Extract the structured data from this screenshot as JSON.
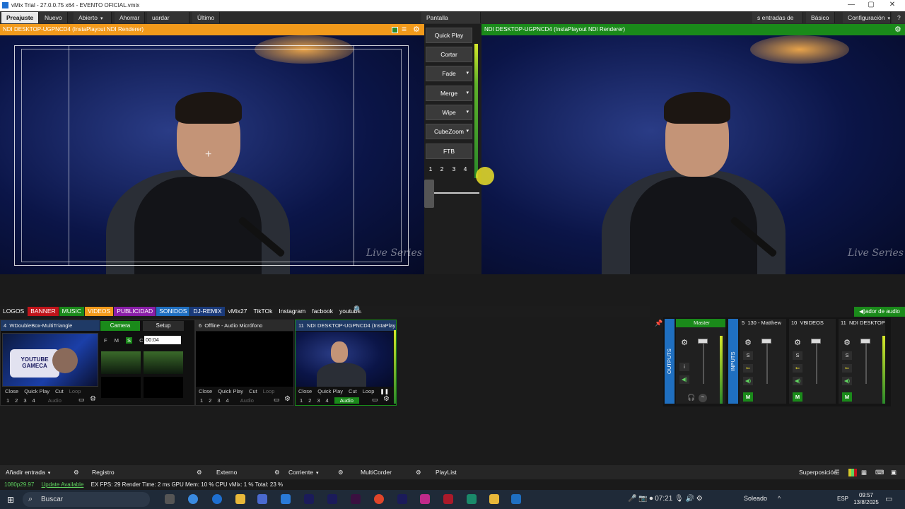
{
  "window": {
    "title": "vMix Trial - 27.0.0.75 x64 - EVENTO OFICIAL.vmix"
  },
  "menu": {
    "items": [
      "Preajuste",
      "Nuevo",
      "Abierto",
      "Ahorrar",
      "uardar com",
      "Último"
    ],
    "fullscreen": "Pantalla Completa",
    "right_items": [
      "s entradas de pa",
      "Básico",
      "Configuración",
      "?"
    ]
  },
  "preview": {
    "title": "NDI DESKTOP-UGPNCD4 (InstaPlayout NDI Renderer)"
  },
  "program": {
    "title": "NDI DESKTOP-UGPNCD4 (InstaPlayout NDI Renderer)"
  },
  "watermark": "Live Series",
  "transitions": {
    "buttons": [
      "Quick Play",
      "Cortar",
      "Fade",
      "Merge",
      "Wipe",
      "CubeZoom",
      "FTB"
    ],
    "numbers": [
      "1",
      "2",
      "3",
      "4"
    ]
  },
  "tabs": [
    {
      "label": "LOGOS",
      "color": "#1c1c1c"
    },
    {
      "label": "BANNER",
      "color": "#c0141a"
    },
    {
      "label": "MUSIC",
      "color": "#1a8a1a"
    },
    {
      "label": "VIDEOS",
      "color": "#f29a1b"
    },
    {
      "label": "PUBLICIDAD",
      "color": "#8a1ea8"
    },
    {
      "label": "SONIDOS",
      "color": "#1f6fc0"
    },
    {
      "label": "DJ-REMIX",
      "color": "#1a3a7a"
    },
    {
      "label": "vMix27",
      "color": "#1c1c1c"
    },
    {
      "label": "TikTOk",
      "color": "#1c1c1c"
    },
    {
      "label": "Instagram",
      "color": "#1c1c1c"
    },
    {
      "label": "facbook",
      "color": "#1c1c1c"
    },
    {
      "label": "youtube",
      "color": "#1c1c1c"
    }
  ],
  "audio_mixer_label": "ador de audio",
  "inputs": [
    {
      "num": "4",
      "title": "WDoubleBox-MultiTriangle",
      "camera": "Camera",
      "setup": "Setup",
      "flags": [
        "F",
        "M",
        "S",
        "C"
      ],
      "time": "00:04",
      "thumb_text": "YOUTUBE GAMECA"
    },
    {
      "num": "6",
      "title": "Offline - Audio Micrófono"
    },
    {
      "num": "11",
      "title": "NDI DESKTOP-UGPNCD4 (InstaPlay"
    }
  ],
  "input_ctrl": {
    "close": "Close",
    "qp": "Quick Play",
    "cut": "Cut",
    "loop": "Loop",
    "nums": [
      "1",
      "2",
      "3",
      "4"
    ],
    "audio": "Audio"
  },
  "audio": {
    "outputs_label": "OUTPUTS",
    "inputs_label": "INPUTS",
    "master": "Master",
    "strips": [
      {
        "num": "5",
        "name": "130 - Matthew"
      },
      {
        "num": "10",
        "name": "VBIDEOS"
      },
      {
        "num": "11",
        "name": "NDI DESKTOP"
      }
    ],
    "s": "S",
    "m": "M"
  },
  "bottom": {
    "add": "Añadir entrada",
    "record": "Registro",
    "external": "Externo",
    "stream": "Corriente",
    "multicorder": "MultiCorder",
    "playlist": "PlayList",
    "overlay": "Superposición"
  },
  "status": {
    "res": "1080p29.97",
    "update": "Update Available",
    "text": "EX  FPS: 29  Render Time: 2 ms  GPU Mem: 10 %  CPU vMix: 1 %  Total: 23 %"
  },
  "taskbar": {
    "search": "Buscar",
    "weather": "Soleado",
    "lang": "ESP",
    "time": "09:57",
    "date": "13/8/2025",
    "rec": "07:21"
  },
  "colors": {
    "preview": "#f29a1b",
    "program": "#1a8a1a",
    "accent": "#1f6fc0"
  }
}
